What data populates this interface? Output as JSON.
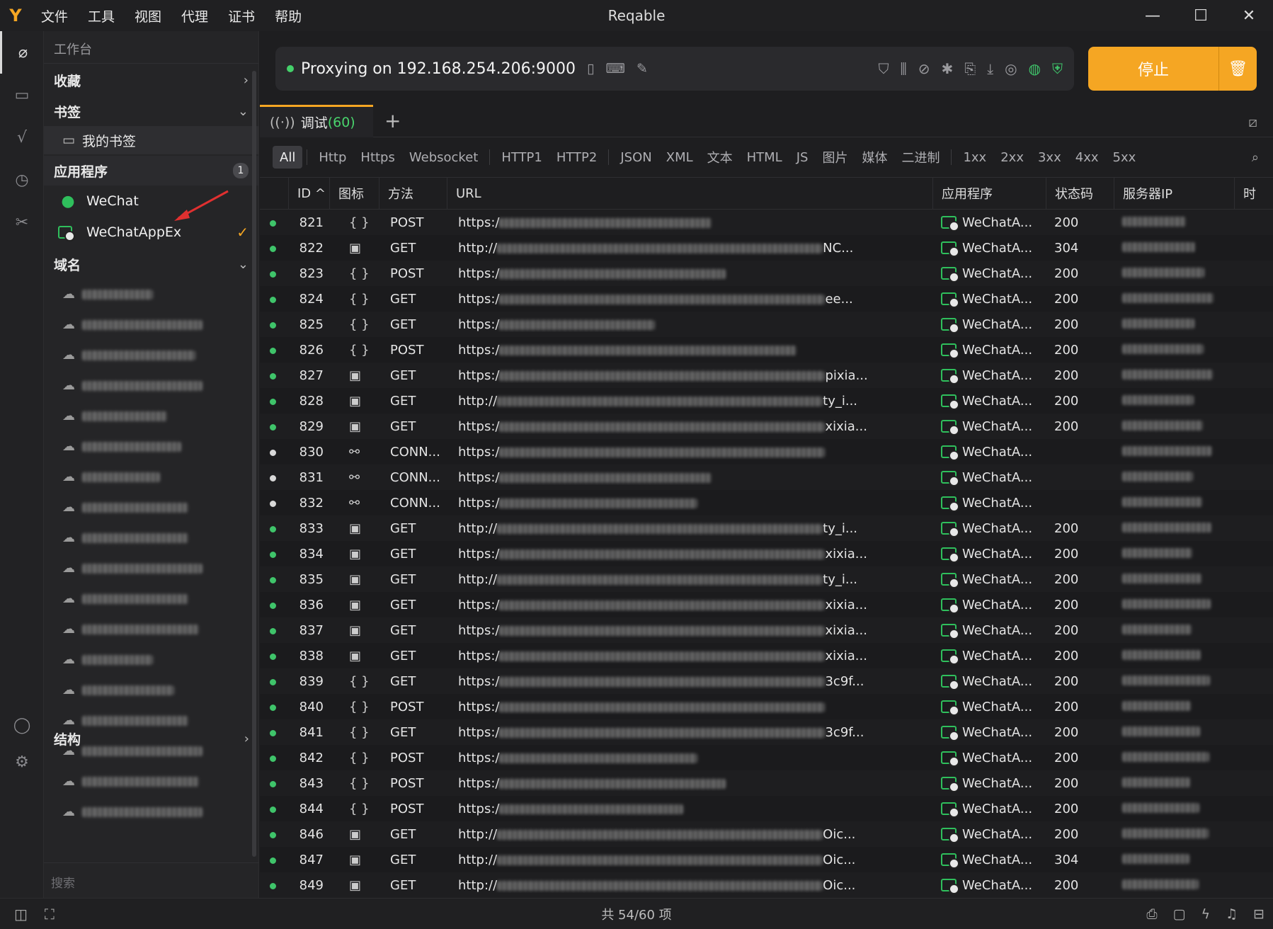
{
  "app": {
    "title": "Reqable",
    "logo": "Y",
    "menu": [
      "文件",
      "工具",
      "视图",
      "代理",
      "证书",
      "帮助"
    ]
  },
  "window": {
    "minimize": "—",
    "maximize": "☐",
    "close": "✕"
  },
  "sidebar": {
    "header": "工作台",
    "favorites": "收藏",
    "bookmarks": "书签",
    "my_bookmarks": "我的书签",
    "apps_title": "应用程序",
    "apps_badge": "1",
    "apps": [
      {
        "name": "WeChat"
      },
      {
        "name": "WeChatAppEx"
      }
    ],
    "selected_check": "✓",
    "domains_title": "域名",
    "structure": "结构",
    "search_placeholder": "搜索"
  },
  "proxy": {
    "status": "Proxying on 192.168.254.206:9000",
    "stop_label": "停止"
  },
  "tabs": {
    "debug_label": "调试",
    "debug_count": "(60)",
    "plus": "+"
  },
  "filters": [
    [
      "All"
    ],
    [
      "Http",
      "Https",
      "Websocket"
    ],
    [
      "HTTP1",
      "HTTP2"
    ],
    [
      "JSON",
      "XML",
      "文本",
      "HTML",
      "JS",
      "图片",
      "媒体",
      "二进制"
    ],
    [
      "1xx",
      "2xx",
      "3xx",
      "4xx",
      "5xx"
    ]
  ],
  "table": {
    "headers": {
      "id": "ID ^",
      "icon": "图标",
      "method": "方法",
      "url": "URL",
      "app": "应用程序",
      "status": "状态码",
      "ip": "服务器IP",
      "time": "时"
    },
    "rows": [
      {
        "id": "821",
        "icon": "{}",
        "method": "POST",
        "url": "https:/",
        "tail": "",
        "app": "WeChatA...",
        "status": "200",
        "dot": "g"
      },
      {
        "id": "822",
        "icon": "img",
        "method": "GET",
        "url": "http://",
        "tail": "NC...",
        "app": "WeChatA...",
        "status": "304",
        "dot": "g"
      },
      {
        "id": "823",
        "icon": "{}",
        "method": "POST",
        "url": "https:/",
        "tail": "",
        "app": "WeChatA...",
        "status": "200",
        "dot": "g"
      },
      {
        "id": "824",
        "icon": "{}",
        "method": "GET",
        "url": "https:/",
        "tail": "ee...",
        "app": "WeChatA...",
        "status": "200",
        "dot": "g"
      },
      {
        "id": "825",
        "icon": "{}",
        "method": "GET",
        "url": "https:/",
        "tail": "",
        "app": "WeChatA...",
        "status": "200",
        "dot": "g"
      },
      {
        "id": "826",
        "icon": "{}",
        "method": "POST",
        "url": "https:/",
        "tail": "",
        "app": "WeChatA...",
        "status": "200",
        "dot": "g"
      },
      {
        "id": "827",
        "icon": "img",
        "method": "GET",
        "url": "https:/",
        "tail": "pixia...",
        "app": "WeChatA...",
        "status": "200",
        "dot": "g"
      },
      {
        "id": "828",
        "icon": "img",
        "method": "GET",
        "url": "http://",
        "tail": "ty_i...",
        "app": "WeChatA...",
        "status": "200",
        "dot": "g"
      },
      {
        "id": "829",
        "icon": "img",
        "method": "GET",
        "url": "https:/",
        "tail": "xixia...",
        "app": "WeChatA...",
        "status": "200",
        "dot": "g"
      },
      {
        "id": "830",
        "icon": "link",
        "method": "CONN...",
        "url": "https:/",
        "tail": "",
        "app": "WeChatA...",
        "status": "",
        "dot": "w"
      },
      {
        "id": "831",
        "icon": "link",
        "method": "CONN...",
        "url": "https:/",
        "tail": "",
        "app": "WeChatA...",
        "status": "",
        "dot": "w"
      },
      {
        "id": "832",
        "icon": "link",
        "method": "CONN...",
        "url": "https:/",
        "tail": "",
        "app": "WeChatA...",
        "status": "",
        "dot": "w"
      },
      {
        "id": "833",
        "icon": "img",
        "method": "GET",
        "url": "http://",
        "tail": "ty_i...",
        "app": "WeChatA...",
        "status": "200",
        "dot": "g"
      },
      {
        "id": "834",
        "icon": "img",
        "method": "GET",
        "url": "https:/",
        "tail": "xixia...",
        "app": "WeChatA...",
        "status": "200",
        "dot": "g"
      },
      {
        "id": "835",
        "icon": "img",
        "method": "GET",
        "url": "http://",
        "tail": "ty_i...",
        "app": "WeChatA...",
        "status": "200",
        "dot": "g"
      },
      {
        "id": "836",
        "icon": "img",
        "method": "GET",
        "url": "https:/",
        "tail": "xixia...",
        "app": "WeChatA...",
        "status": "200",
        "dot": "g"
      },
      {
        "id": "837",
        "icon": "img",
        "method": "GET",
        "url": "https:/",
        "tail": "xixia...",
        "app": "WeChatA...",
        "status": "200",
        "dot": "g"
      },
      {
        "id": "838",
        "icon": "img",
        "method": "GET",
        "url": "https:/",
        "tail": "xixia...",
        "app": "WeChatA...",
        "status": "200",
        "dot": "g"
      },
      {
        "id": "839",
        "icon": "{}",
        "method": "GET",
        "url": "https:/",
        "tail": "3c9f...",
        "app": "WeChatA...",
        "status": "200",
        "dot": "g"
      },
      {
        "id": "840",
        "icon": "{}",
        "method": "POST",
        "url": "https:/",
        "tail": "",
        "app": "WeChatA...",
        "status": "200",
        "dot": "g"
      },
      {
        "id": "841",
        "icon": "{}",
        "method": "GET",
        "url": "https:/",
        "tail": "3c9f...",
        "app": "WeChatA...",
        "status": "200",
        "dot": "g"
      },
      {
        "id": "842",
        "icon": "{}",
        "method": "POST",
        "url": "https:/",
        "tail": "",
        "app": "WeChatA...",
        "status": "200",
        "dot": "g"
      },
      {
        "id": "843",
        "icon": "{}",
        "method": "POST",
        "url": "https:/",
        "tail": "",
        "app": "WeChatA...",
        "status": "200",
        "dot": "g"
      },
      {
        "id": "844",
        "icon": "{}",
        "method": "POST",
        "url": "https:/",
        "tail": "",
        "app": "WeChatA...",
        "status": "200",
        "dot": "g"
      },
      {
        "id": "846",
        "icon": "img",
        "method": "GET",
        "url": "http://",
        "tail": "Oic...",
        "app": "WeChatA...",
        "status": "200",
        "dot": "g"
      },
      {
        "id": "847",
        "icon": "img",
        "method": "GET",
        "url": "http://",
        "tail": "Oic...",
        "app": "WeChatA...",
        "status": "304",
        "dot": "g"
      },
      {
        "id": "849",
        "icon": "img",
        "method": "GET",
        "url": "http://",
        "tail": "Oic...",
        "app": "WeChatA...",
        "status": "200",
        "dot": "g"
      }
    ]
  },
  "statusbar": {
    "count": "共 54/60 项"
  },
  "colors": {
    "accent": "#f5a623",
    "ok": "#3fc46a"
  }
}
